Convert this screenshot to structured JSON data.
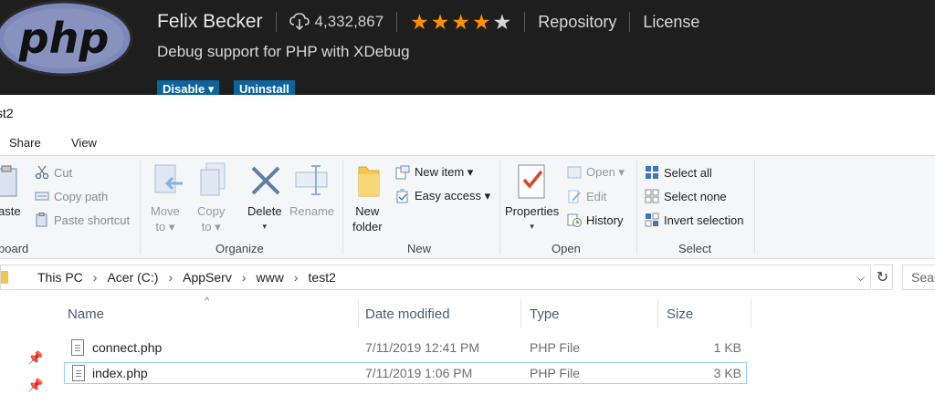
{
  "extension": {
    "logo_text": "php",
    "publisher": "Felix Becker",
    "installs": "4,332,867",
    "rating": 4,
    "rating_max": 5,
    "links": [
      "Repository",
      "License"
    ],
    "description": "Debug support for PHP with XDebug",
    "buttons": {
      "disable": "Disable ▾",
      "uninstall": "Uninstall"
    },
    "colors": {
      "background": "#1e1e1e",
      "star": "#ff8e00",
      "button": "#0e639c"
    }
  },
  "explorer": {
    "window_title": "st2",
    "tabs": [
      "Share",
      "View"
    ],
    "ribbon": {
      "clipboard": {
        "label": "board",
        "paste": "aste",
        "cut": "Cut",
        "copy_path": "Copy path",
        "paste_shortcut": "Paste shortcut"
      },
      "organize": {
        "label": "Organize",
        "move_to": [
          "Move",
          "to ▾"
        ],
        "copy_to": [
          "Copy",
          "to ▾"
        ],
        "delete": [
          "Delete",
          "▾"
        ],
        "rename": "Rename"
      },
      "new": {
        "label": "New",
        "new_folder": [
          "New",
          "folder"
        ],
        "new_item": "New item ▾",
        "easy_access": "Easy access ▾"
      },
      "open": {
        "label": "Open",
        "properties": [
          "Properties",
          "▾"
        ],
        "open": "Open ▾",
        "edit": "Edit",
        "history": "History"
      },
      "select": {
        "label": "Select",
        "select_all": "Select all",
        "select_none": "Select none",
        "invert_selection": "Invert selection"
      }
    },
    "address": {
      "crumbs": [
        "This PC",
        "Acer (C:)",
        "AppServ",
        "www",
        "test2"
      ],
      "search_placeholder": "Sear"
    },
    "columns": {
      "name": "Name",
      "date": "Date modified",
      "type": "Type",
      "size": "Size"
    },
    "files": [
      {
        "name": "connect.php",
        "date": "7/11/2019 12:41 PM",
        "type": "PHP File",
        "size": "1 KB"
      },
      {
        "name": "index.php",
        "date": "7/11/2019 1:06 PM",
        "type": "PHP File",
        "size": "3 KB"
      }
    ]
  }
}
